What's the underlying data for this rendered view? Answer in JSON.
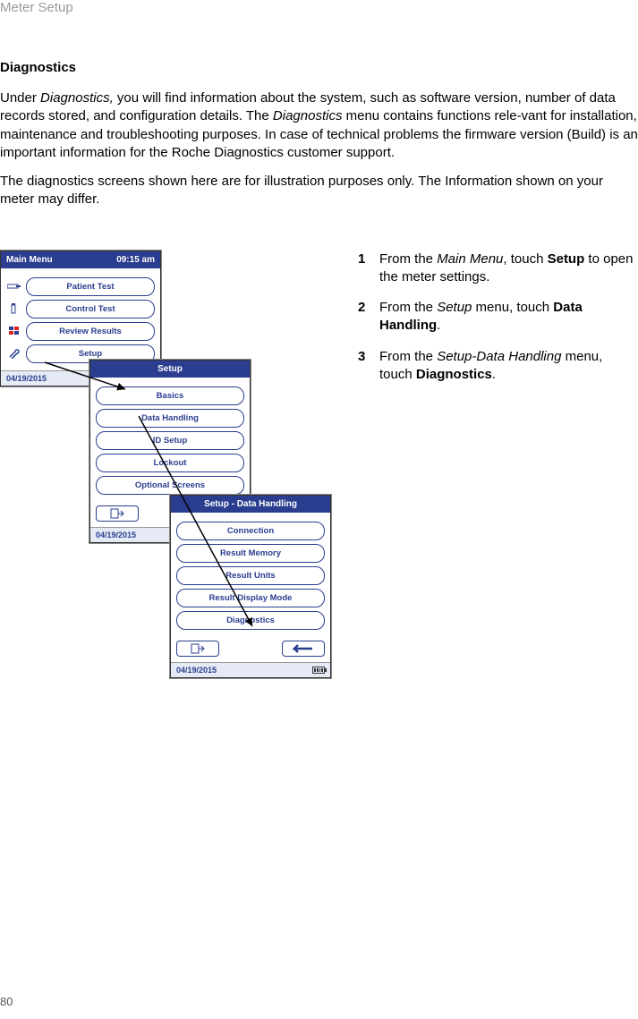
{
  "header": "Meter Setup",
  "section_title": "Diagnostics",
  "para1_a": "Under ",
  "para1_b": "Diagnostics,",
  "para1_c": " you will find information about the system, such as software version, number of data records stored, and configuration details. The ",
  "para1_d": "Diagnostics",
  "para1_e": " menu contains functions rele-vant for installation, maintenance and troubleshooting purposes. In case of technical problems the firmware version (Build) is an important information for the Roche Diagnostics customer support.",
  "para2": "The diagnostics screens shown here are for illustration purposes only. The Information shown on your meter may differ.",
  "screen1": {
    "title": "Main Menu",
    "time": "09:15 am",
    "btn1": "Patient Test",
    "btn2": "Control Test",
    "btn3": "Review Results",
    "btn4": "Setup",
    "date": "04/19/2015"
  },
  "screen2": {
    "title": "Setup",
    "btn1": "Basics",
    "btn2": "Data Handling",
    "btn3": "ID Setup",
    "btn4": "Lockout",
    "btn5": "Optional Screens",
    "date": "04/19/2015"
  },
  "screen3": {
    "title": "Setup - Data Handling",
    "btn1": "Connection",
    "btn2": "Result Memory",
    "btn3": "Result Units",
    "btn4": "Result Display Mode",
    "btn5": "Diagnostics",
    "date": "04/19/2015"
  },
  "steps": {
    "s1_a": "From the ",
    "s1_b": "Main Menu",
    "s1_c": ", touch ",
    "s1_d": "Setup",
    "s1_e": " to open the meter settings.",
    "s2_a": "From the ",
    "s2_b": "Setup",
    "s2_c": " menu, touch ",
    "s2_d": "Data Handling",
    "s2_e": ".",
    "s3_a": "From the ",
    "s3_b": "Setup-Data Handling",
    "s3_c": " menu, touch ",
    "s3_d": "Diagnostics",
    "s3_e": "."
  },
  "page_num": "80"
}
